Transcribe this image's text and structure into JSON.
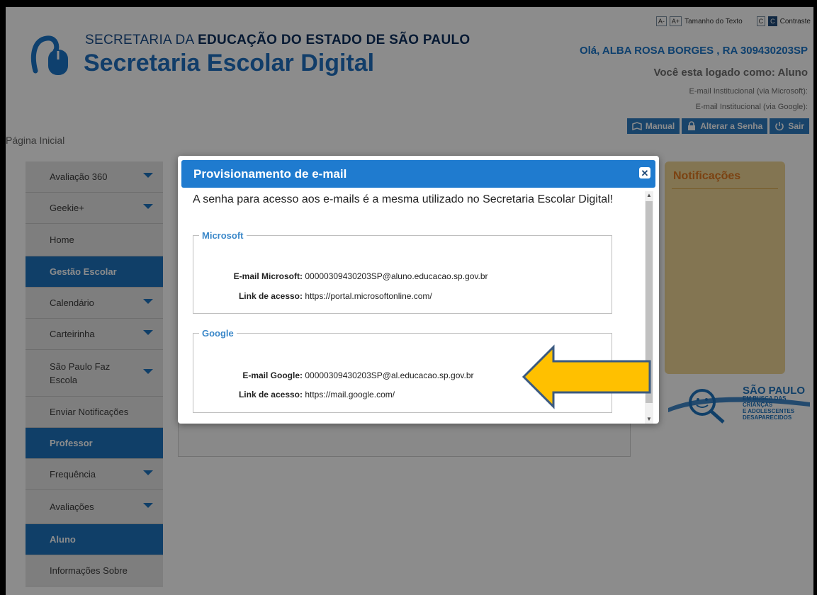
{
  "header": {
    "brand_top_light": "SECRETARIA DA ",
    "brand_top_bold": "EDUCAÇÃO DO ESTADO DE SÃO PAULO",
    "brand_main": "Secretaria Escolar Digital",
    "text_size_minus": "A-",
    "text_size_plus": "A+",
    "text_size_label": "Tamanho do Texto",
    "contrast_light": "C",
    "contrast_dark": "C",
    "contrast_label": "Contraste",
    "greeting": "Olá, ALBA ROSA BORGES , RA 309430203SP",
    "logged_as": "Você esta logado como: Aluno",
    "email_microsoft_label": "E-mail Institucional (via Microsoft):",
    "email_google_label": "E-mail Institucional (via Google):",
    "buttons": {
      "manual": "Manual",
      "change_password": "Alterar a Senha",
      "logout": "Sair"
    }
  },
  "breadcrumb": "Página Inicial",
  "sidebar": {
    "items": [
      {
        "label": "Avaliação 360",
        "type": "item",
        "caret": true
      },
      {
        "label": "Geekie+",
        "type": "item",
        "caret": true
      },
      {
        "label": "Home",
        "type": "item",
        "caret": false
      },
      {
        "label": "Gestão Escolar",
        "type": "section",
        "caret": false
      },
      {
        "label": "Calendário",
        "type": "item",
        "caret": true
      },
      {
        "label": "Carteirinha",
        "type": "item",
        "caret": true
      },
      {
        "label": "São Paulo Faz Escola",
        "type": "item",
        "caret": true
      },
      {
        "label": "Enviar Notificações",
        "type": "item",
        "caret": false
      },
      {
        "label": "Professor",
        "type": "section",
        "caret": false
      },
      {
        "label": "Frequência",
        "type": "item",
        "caret": true
      },
      {
        "label": "Avaliações",
        "type": "item",
        "caret": true
      },
      {
        "label": "Aluno",
        "type": "section",
        "caret": false
      },
      {
        "label": "Informações Sobre",
        "type": "item",
        "caret": false
      }
    ]
  },
  "notifications": {
    "title": "Notificações"
  },
  "campaign": {
    "title": "SÃO PAULO",
    "line1": "EM BUSCA DAS CRIANÇAS",
    "line2": "E ADOLESCENTES",
    "line3": "DESAPARECIDOS"
  },
  "modal": {
    "title": "Provisionamento de e-mail",
    "message": "A senha para acesso aos e-mails é a mesma utilizado no Secretaria Escolar Digital!",
    "microsoft": {
      "legend": "Microsoft",
      "email_label": "E-mail Microsoft:",
      "email_value": "00000309430203SP@aluno.educacao.sp.gov.br",
      "link_label": "Link de acesso:",
      "link_value": "https://portal.microsoftonline.com/"
    },
    "google": {
      "legend": "Google",
      "email_label": "E-mail Google:",
      "email_value": "00000309430203SP@al.educacao.sp.gov.br",
      "link_label": "Link de acesso:",
      "link_value": "https://mail.google.com/"
    }
  },
  "colors": {
    "primary": "#1e73be",
    "arrow_fill": "#ffc000",
    "arrow_stroke": "#3b5a80",
    "notif_bg": "#efd595"
  }
}
